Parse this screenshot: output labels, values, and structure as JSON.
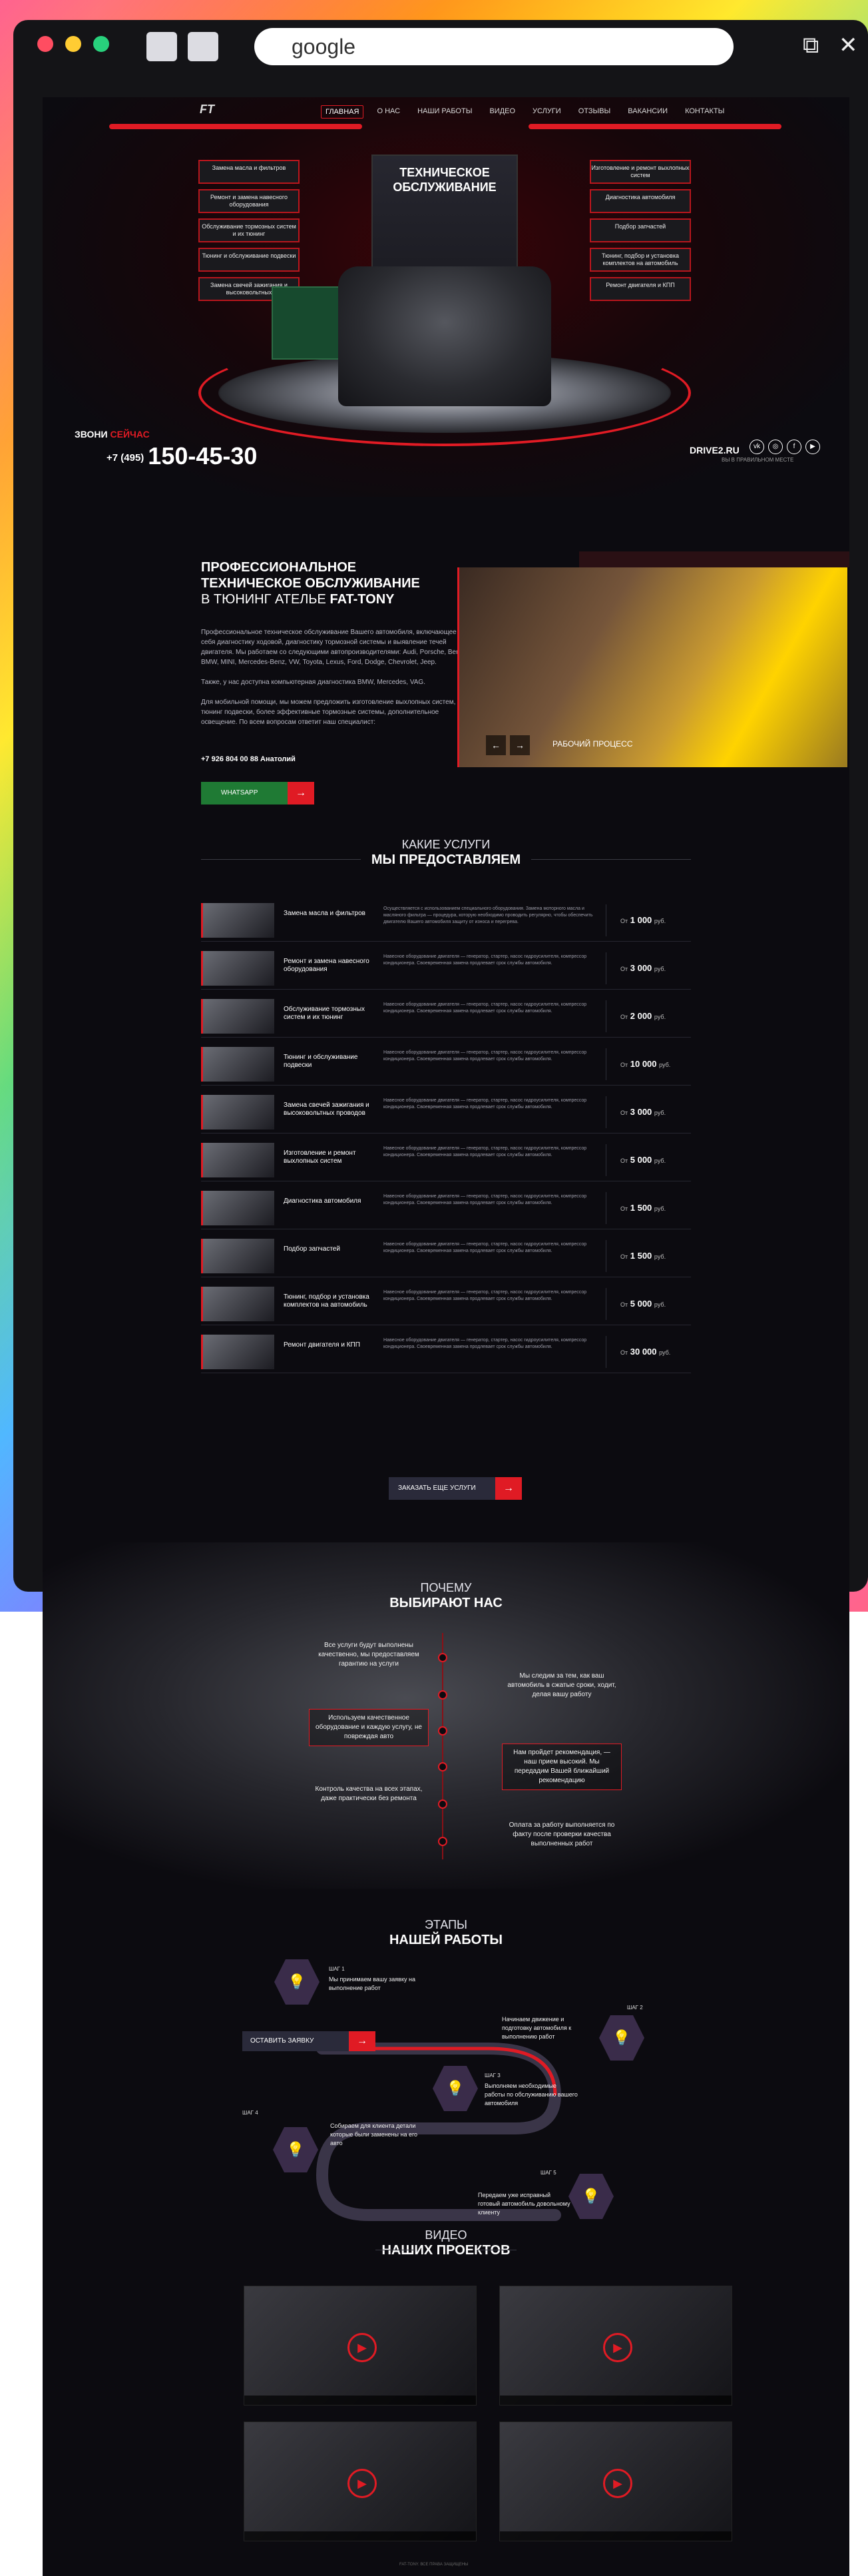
{
  "browser": {
    "url": "google",
    "window_icons": [
      "restore-icon",
      "close-icon"
    ]
  },
  "nav": {
    "items": [
      "ГЛАВНАЯ",
      "О НАС",
      "НАШИ РАБОТЫ",
      "ВИДЕО",
      "УСЛУГИ",
      "ОТЗЫВЫ",
      "ВАКАНСИИ",
      "КОНТАКТЫ"
    ]
  },
  "hero": {
    "title": "ТЕХНИЧЕСКОЕ ОБСЛУЖИВАНИЕ",
    "left_services": [
      "Замена масла и фильтров",
      "Ремонт и замена навесного оборудования",
      "Обслуживание тормозных систем и их тюнинг",
      "Тюнинг и обслуживание подвески",
      "Замена свечей зажигания и высоковольтных"
    ],
    "right_services": [
      "Изготовление и ремонт выхлопных систем",
      "Диагностика автомобиля",
      "Подбор запчастей",
      "Тюнинг, подбор и установка комплектов на автомобиль",
      "Ремонт двигателя и КПП"
    ],
    "call_prefix": "ЗВОНИ",
    "call_accent": "СЕЙЧАС",
    "phone_code": "+7 (495)",
    "phone": "150-45-30",
    "drive2": "DRIVE2.RU",
    "footnote": "ВЫ В ПРАВИЛЬНОМ МЕСТЕ"
  },
  "intro": {
    "title_line1": "ПРОФЕССИОНАЛЬНОЕ",
    "title_line2": "ТЕХНИЧЕСКОЕ ОБСЛУЖИВАНИЕ",
    "title_line3": "В ТЮНИНГ АТЕЛЬЕ",
    "title_brand": "FAT-TONY",
    "text1": "Профессиональное техническое обслуживание Вашего автомобиля, включающее в себя диагностику ходовой, диагностику тормозной системы и выявление течей двигателя. Мы работаем со следующими автопроизводителями: Audi, Porsche, Bentley, BMW, MINI, Mercedes-Benz, VW, Toyota, Lexus, Ford, Dodge, Chevrolet, Jeep.",
    "text2": "Также, у нас доступна компьютерная диагностика BMW, Mercedes, VAG.",
    "text3": "Для мобильной помощи, мы можем предложить изготовление выхлопных систем, тюнинг подвески, более эффективные тормозные системы, дополнительное освещение. По всем вопросам ответит наш специалист:",
    "phone": "+7 926 804 00 88 Анатолий",
    "button": "WHATSAPP",
    "photo_caption": "РАБОЧИЙ ПРОЦЕСС"
  },
  "services": {
    "subtitle": "КАКИЕ УСЛУГИ",
    "title": "МЫ ПРЕДОСТАВЛЯЕМ",
    "rows": [
      {
        "name": "Замена масла и фильтров",
        "desc": "Осуществляется с использованием специального оборудования. Замена моторного масла и масляного фильтра — процедура, которую необходимо проводить регулярно, чтобы обеспечить двигателю Вашего автомобиля защиту от износа и перегрева.",
        "price": "1 000"
      },
      {
        "name": "Ремонт и замена навесного оборудования",
        "desc": "Навесное оборудование двигателя — генератор, стартер, насос гидроусилителя, компрессор кондиционера. Своевременная замена продлевает срок службы автомобиля.",
        "price": "3 000"
      },
      {
        "name": "Обслуживание тормозных систем и их тюнинг",
        "desc": "Навесное оборудование двигателя — генератор, стартер, насос гидроусилителя, компрессор кондиционера. Своевременная замена продлевает срок службы автомобиля.",
        "price": "2 000"
      },
      {
        "name": "Тюнинг и обслуживание подвески",
        "desc": "Навесное оборудование двигателя — генератор, стартер, насос гидроусилителя, компрессор кондиционера. Своевременная замена продлевает срок службы автомобиля.",
        "price": "10 000"
      },
      {
        "name": "Замена свечей зажигания и высоковольтных проводов",
        "desc": "Навесное оборудование двигателя — генератор, стартер, насос гидроусилителя, компрессор кондиционера. Своевременная замена продлевает срок службы автомобиля.",
        "price": "3 000"
      },
      {
        "name": "Изготовление и ремонт выхлопных систем",
        "desc": "Навесное оборудование двигателя — генератор, стартер, насос гидроусилителя, компрессор кондиционера. Своевременная замена продлевает срок службы автомобиля.",
        "price": "5 000"
      },
      {
        "name": "Диагностика автомобиля",
        "desc": "Навесное оборудование двигателя — генератор, стартер, насос гидроусилителя, компрессор кондиционера. Своевременная замена продлевает срок службы автомобиля.",
        "price": "1 500"
      },
      {
        "name": "Подбор запчастей",
        "desc": "Навесное оборудование двигателя — генератор, стартер, насос гидроусилителя, компрессор кондиционера. Своевременная замена продлевает срок службы автомобиля.",
        "price": "1 500"
      },
      {
        "name": "Тюнинг, подбор и установка комплектов на автомобиль",
        "desc": "Навесное оборудование двигателя — генератор, стартер, насос гидроусилителя, компрессор кондиционера. Своевременная замена продлевает срок службы автомобиля.",
        "price": "5 000"
      },
      {
        "name": "Ремонт двигателя и КПП",
        "desc": "Навесное оборудование двигателя — генератор, стартер, насос гидроусилителя, компрессор кондиционера. Своевременная замена продлевает срок службы автомобиля.",
        "price": "30 000"
      }
    ],
    "price_prefix": "От",
    "price_unit": "руб.",
    "more_button": "ЗАКАЗАТЬ ЕЩЕ УСЛУГИ"
  },
  "why": {
    "subtitle": "ПОЧЕМУ",
    "title": "ВЫБИРАЮТ НАС",
    "items": [
      "Все услуги будут выполнены качественно, мы предоставляем гарантию на услуги",
      "Мы следим за тем, как ваш автомобиль в сжатые сроки, ходит, делая вашу работу",
      "Используем качественное оборудование и каждую услугу, не повреждая авто",
      "Нам пройдет рекомендация, — наш прием высокий. Мы передадим Вашей ближайший рекомендацию",
      "Контроль качества на всех этапах, даже практически без ремонта",
      "Оплата за работу выполняется по факту после проверки качества выполненных работ"
    ]
  },
  "stages": {
    "subtitle": "ЭТАПЫ",
    "title": "НАШЕЙ РАБОТЫ",
    "order_button": "ОСТАВИТЬ ЗАЯВКУ",
    "steps": [
      {
        "label": "ШАГ 1",
        "text": "Мы принимаем вашу заявку на выполнение работ"
      },
      {
        "label": "ШАГ 2",
        "text": "Начинаем движение и подготовку автомобиля к выполнению работ"
      },
      {
        "label": "ШАГ 3",
        "text": "Выполняем необходимые работы по обслуживанию вашего автомобиля"
      },
      {
        "label": "ШАГ 4",
        "text": "Собираем для клиента детали которые были заменены на его авто"
      },
      {
        "label": "ШАГ 5",
        "text": "Передаем уже исправный готовый автомобиль довольному клиенту"
      }
    ]
  },
  "videos": {
    "subtitle": "ВИДЕО",
    "title": "НАШИХ ПРОЕКТОВ"
  },
  "footer": {
    "note": "FAT-TONY. ВСЕ ПРАВА ЗАЩИЩЕНЫ"
  }
}
